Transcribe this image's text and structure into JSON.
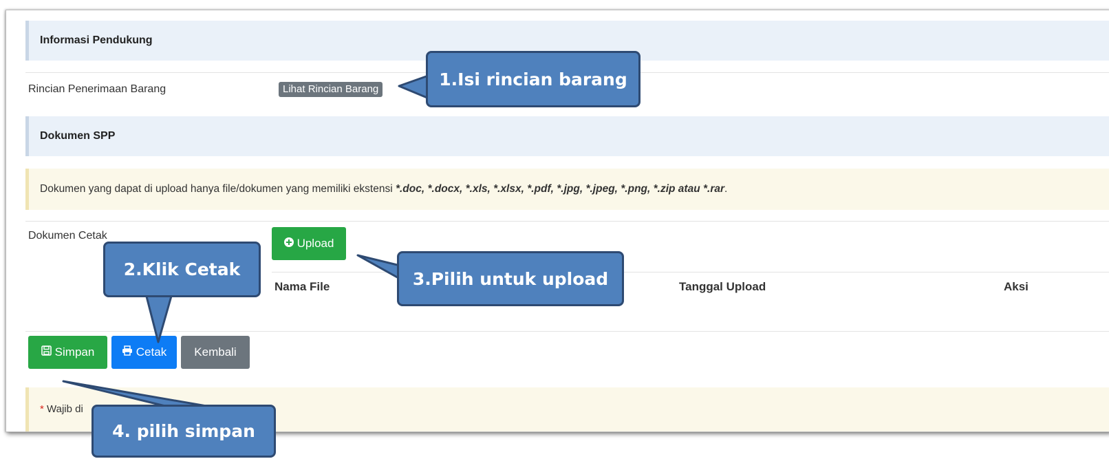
{
  "sections": {
    "informasi_pendukung": "Informasi Pendukung",
    "dokumen_spp": "Dokumen SPP"
  },
  "rincian": {
    "label": "Rincian Penerimaan Barang",
    "button": "Lihat Rincian Barang"
  },
  "info": {
    "prefix": "Dokumen yang dapat di upload hanya file/dokumen yang memiliki ekstensi ",
    "extensions": "*.doc, *.docx, *.xls, *.xlsx, *.pdf, *.jpg, *.jpeg, *.png, *.zip atau *.rar",
    "suffix": "."
  },
  "dokumen_cetak": {
    "label": "Dokumen Cetak",
    "upload_button": "Upload",
    "columns": [
      "Nama File",
      "Tanggal Upload",
      "Aksi"
    ]
  },
  "actions": {
    "simpan": "Simpan",
    "cetak": "Cetak",
    "kembali": "Kembali"
  },
  "required_note": {
    "star": "*",
    "text": "Wajib di"
  },
  "callouts": {
    "c1": "1.Isi rincian barang",
    "c2": "2.Klik Cetak",
    "c3": "3.Pilih untuk upload",
    "c4": "4. pilih simpan"
  },
  "colors": {
    "callout_fill": "#4f81bd",
    "success": "#28a745",
    "primary": "#0d7cf5",
    "secondary": "#6c757d"
  }
}
